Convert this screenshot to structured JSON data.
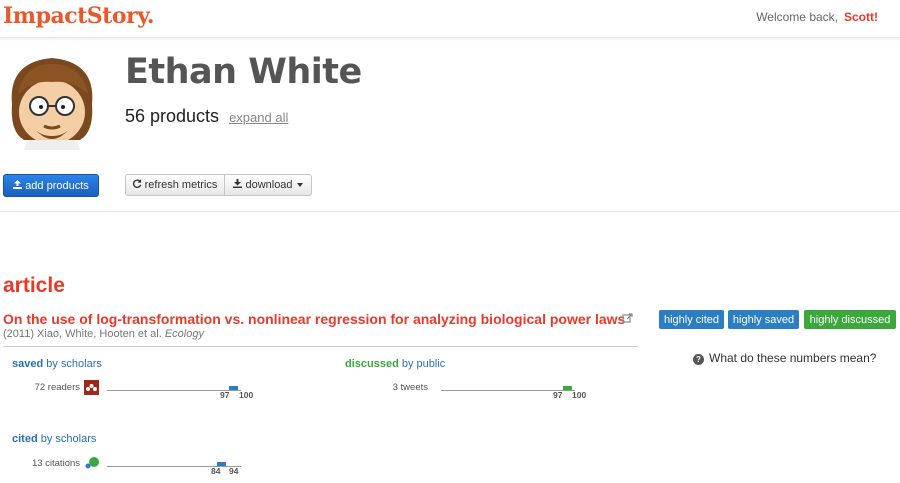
{
  "app": {
    "logo": "ImpactStory."
  },
  "header": {
    "welcome": "Welcome back,",
    "user": "Scott!"
  },
  "profile": {
    "name": "Ethan White",
    "products_count": "56 products",
    "expand_all": "expand all"
  },
  "actions": {
    "add_products": "add products",
    "refresh_metrics": "refresh metrics",
    "download": "download"
  },
  "section": {
    "title": "article"
  },
  "article": {
    "title": "On the use of log-transformation vs. nonlinear regression for analyzing biological power laws",
    "meta_prefix": "(2011) Xiao, White, Hooten et al.",
    "journal": "Ecology",
    "badges": [
      "highly cited",
      "highly saved",
      "highly discussed"
    ]
  },
  "help": {
    "label": "What do these numbers mean?"
  },
  "metrics": {
    "saved": {
      "heading_key": "saved",
      "heading_rest": " by scholars",
      "label": "72 readers",
      "pct_low": "97",
      "pct_high": "100",
      "fill": 0.98
    },
    "discussed": {
      "heading_key": "discussed",
      "heading_rest": " by public",
      "label": "3 tweets",
      "pct_low": "97",
      "pct_high": "100",
      "fill": 0.98
    },
    "cited": {
      "heading_key": "cited",
      "heading_rest": " by scholars",
      "label": "13 citations",
      "pct_low": "84",
      "pct_high": "94",
      "fill": 0.89
    }
  },
  "colors": {
    "accent": "#e8392a",
    "primary": "#1f6fd1",
    "saved": "#2a7ec4",
    "discussed": "#3aa83a"
  }
}
